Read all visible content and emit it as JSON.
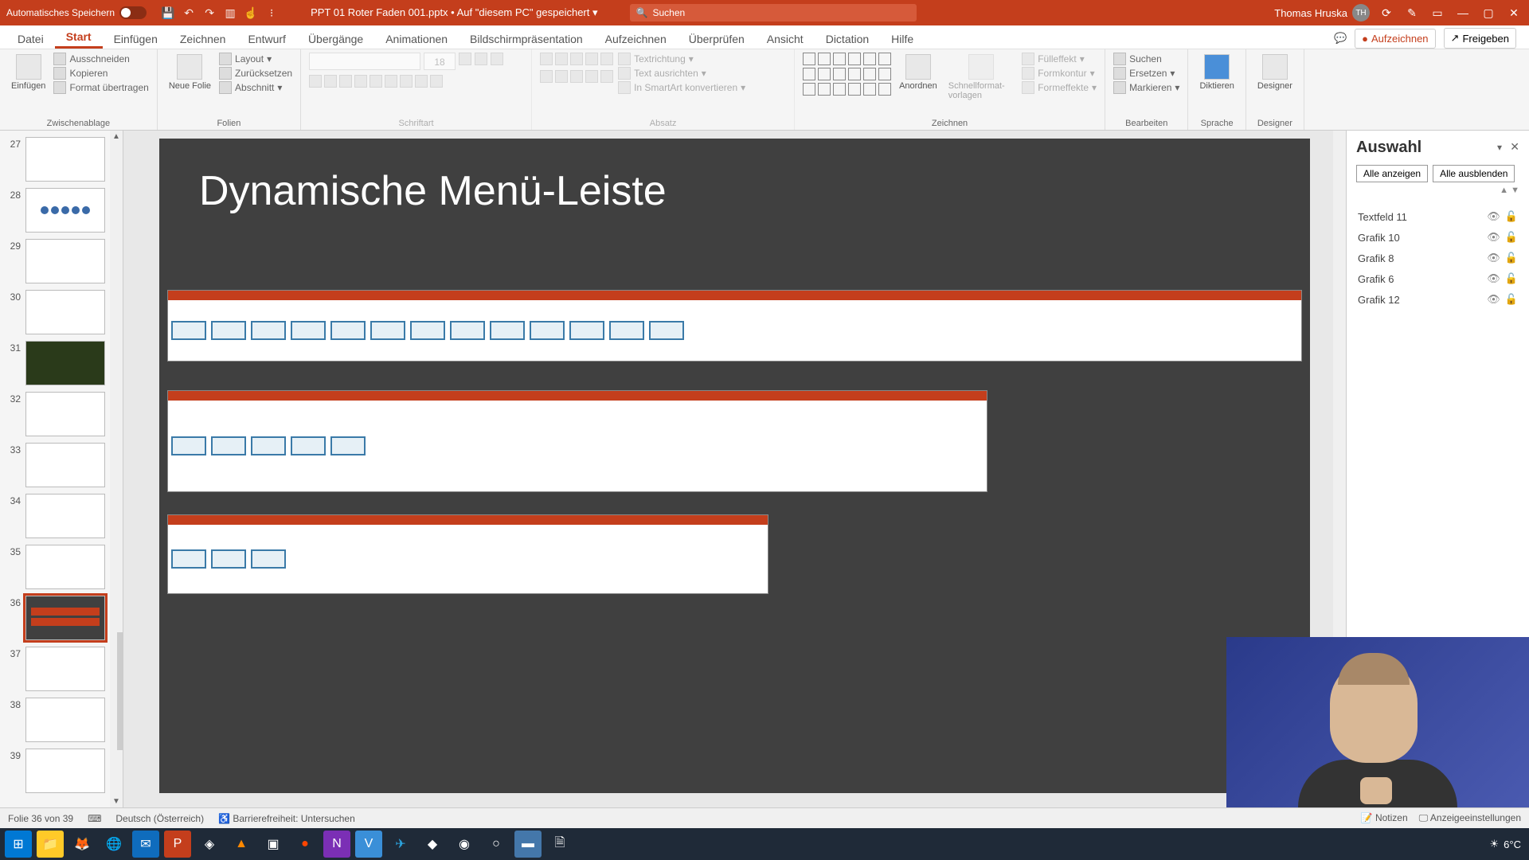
{
  "titlebar": {
    "autosave": "Automatisches Speichern",
    "doc": "PPT 01 Roter Faden 001.pptx • Auf \"diesem PC\" gespeichert",
    "search_placeholder": "Suchen",
    "user": "Thomas Hruska",
    "initials": "TH"
  },
  "tabs": [
    "Datei",
    "Start",
    "Einfügen",
    "Zeichnen",
    "Entwurf",
    "Übergänge",
    "Animationen",
    "Bildschirmpräsentation",
    "Aufzeichnen",
    "Überprüfen",
    "Ansicht",
    "Dictation",
    "Hilfe"
  ],
  "tab_active": 1,
  "topright": {
    "record": "Aufzeichnen",
    "share": "Freigeben"
  },
  "ribbon": {
    "paste": "Einfügen",
    "clipboard": {
      "cut": "Ausschneiden",
      "copy": "Kopieren",
      "format": "Format übertragen",
      "label": "Zwischenablage"
    },
    "slides": {
      "new": "Neue Folie",
      "layout": "Layout",
      "reset": "Zurücksetzen",
      "section": "Abschnitt",
      "label": "Folien"
    },
    "font": {
      "size": "18",
      "label": "Schriftart"
    },
    "para": {
      "dir": "Textrichtung",
      "align": "Text ausrichten",
      "smart": "In SmartArt konvertieren",
      "label": "Absatz"
    },
    "draw": {
      "arrange": "Anordnen",
      "quick": "Schnellformat-vorlagen",
      "fill": "Fülleffekt",
      "outline": "Formkontur",
      "effects": "Formeffekte",
      "label": "Zeichnen"
    },
    "edit": {
      "find": "Suchen",
      "replace": "Ersetzen",
      "select": "Markieren",
      "label": "Bearbeiten"
    },
    "voice": {
      "dictate": "Diktieren",
      "label": "Sprache"
    },
    "designer": {
      "btn": "Designer",
      "label": "Designer"
    }
  },
  "thumbs": [
    {
      "n": "27"
    },
    {
      "n": "28"
    },
    {
      "n": "29"
    },
    {
      "n": "30"
    },
    {
      "n": "31"
    },
    {
      "n": "32"
    },
    {
      "n": "33"
    },
    {
      "n": "34"
    },
    {
      "n": "35"
    },
    {
      "n": "36"
    },
    {
      "n": "37"
    },
    {
      "n": "38"
    },
    {
      "n": "39"
    }
  ],
  "thumb_sel": 9,
  "slide_title": "Dynamische Menü-Leiste",
  "pane": {
    "title": "Auswahl",
    "show_all": "Alle anzeigen",
    "hide_all": "Alle ausblenden",
    "items": [
      "Textfeld 11",
      "Grafik 10",
      "Grafik 8",
      "Grafik 6",
      "Grafik 12"
    ]
  },
  "status": {
    "slide": "Folie 36 von 39",
    "lang": "Deutsch (Österreich)",
    "access": "Barrierefreiheit: Untersuchen",
    "notes": "Notizen",
    "display": "Anzeigeeinstellungen"
  },
  "weather": "6°C"
}
